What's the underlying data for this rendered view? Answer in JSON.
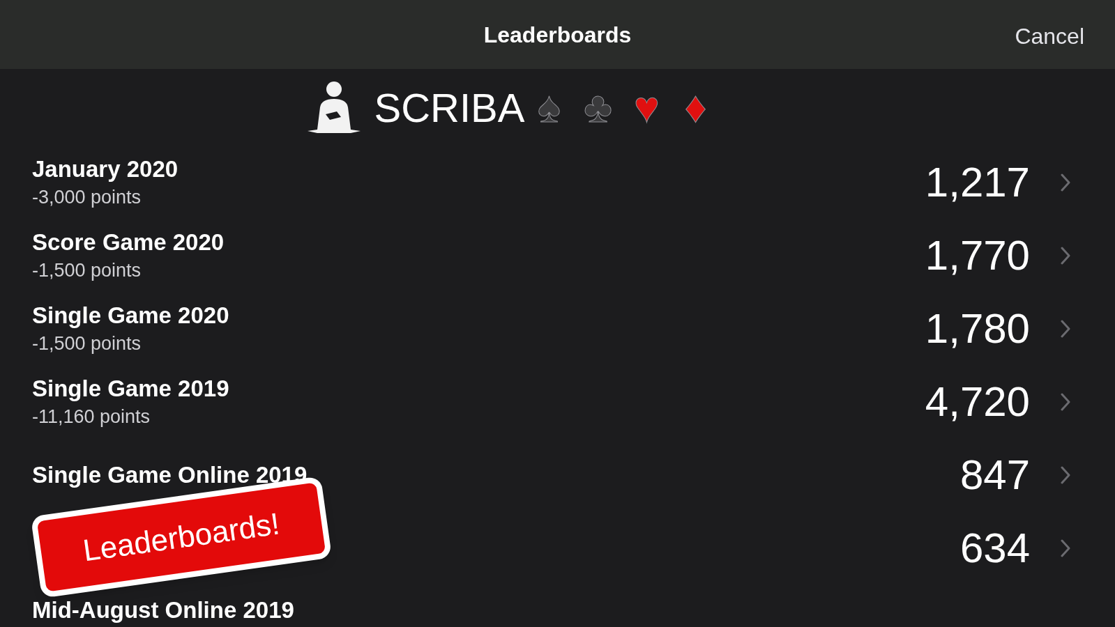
{
  "nav_bar": {
    "title": "Leaderboards",
    "cancel": "Cancel"
  },
  "player": {
    "name": "SCRIBA",
    "suits": [
      {
        "symbol": "♠",
        "color": "#3a3a3c"
      },
      {
        "symbol": "♣",
        "color": "#3a3a3c"
      },
      {
        "symbol": "♥",
        "color": "#e01010"
      },
      {
        "symbol": "♦",
        "color": "#e01010"
      }
    ]
  },
  "rows": [
    {
      "title": "January  2020",
      "subtitle": "-3,000 points",
      "score": "1,217"
    },
    {
      "title": "Score Game 2020",
      "subtitle": "-1,500 points",
      "score": "1,770"
    },
    {
      "title": "Single Game 2020",
      "subtitle": "-1,500 points",
      "score": "1,780"
    },
    {
      "title": "Single Game 2019",
      "subtitle": "-11,160 points",
      "score": "4,720"
    },
    {
      "title": "Single Game Online 2019",
      "score": "847"
    },
    {
      "score": "634"
    },
    {
      "title": "Mid-August Online 2019"
    }
  ],
  "sticker": {
    "text": "Leaderboards!"
  }
}
